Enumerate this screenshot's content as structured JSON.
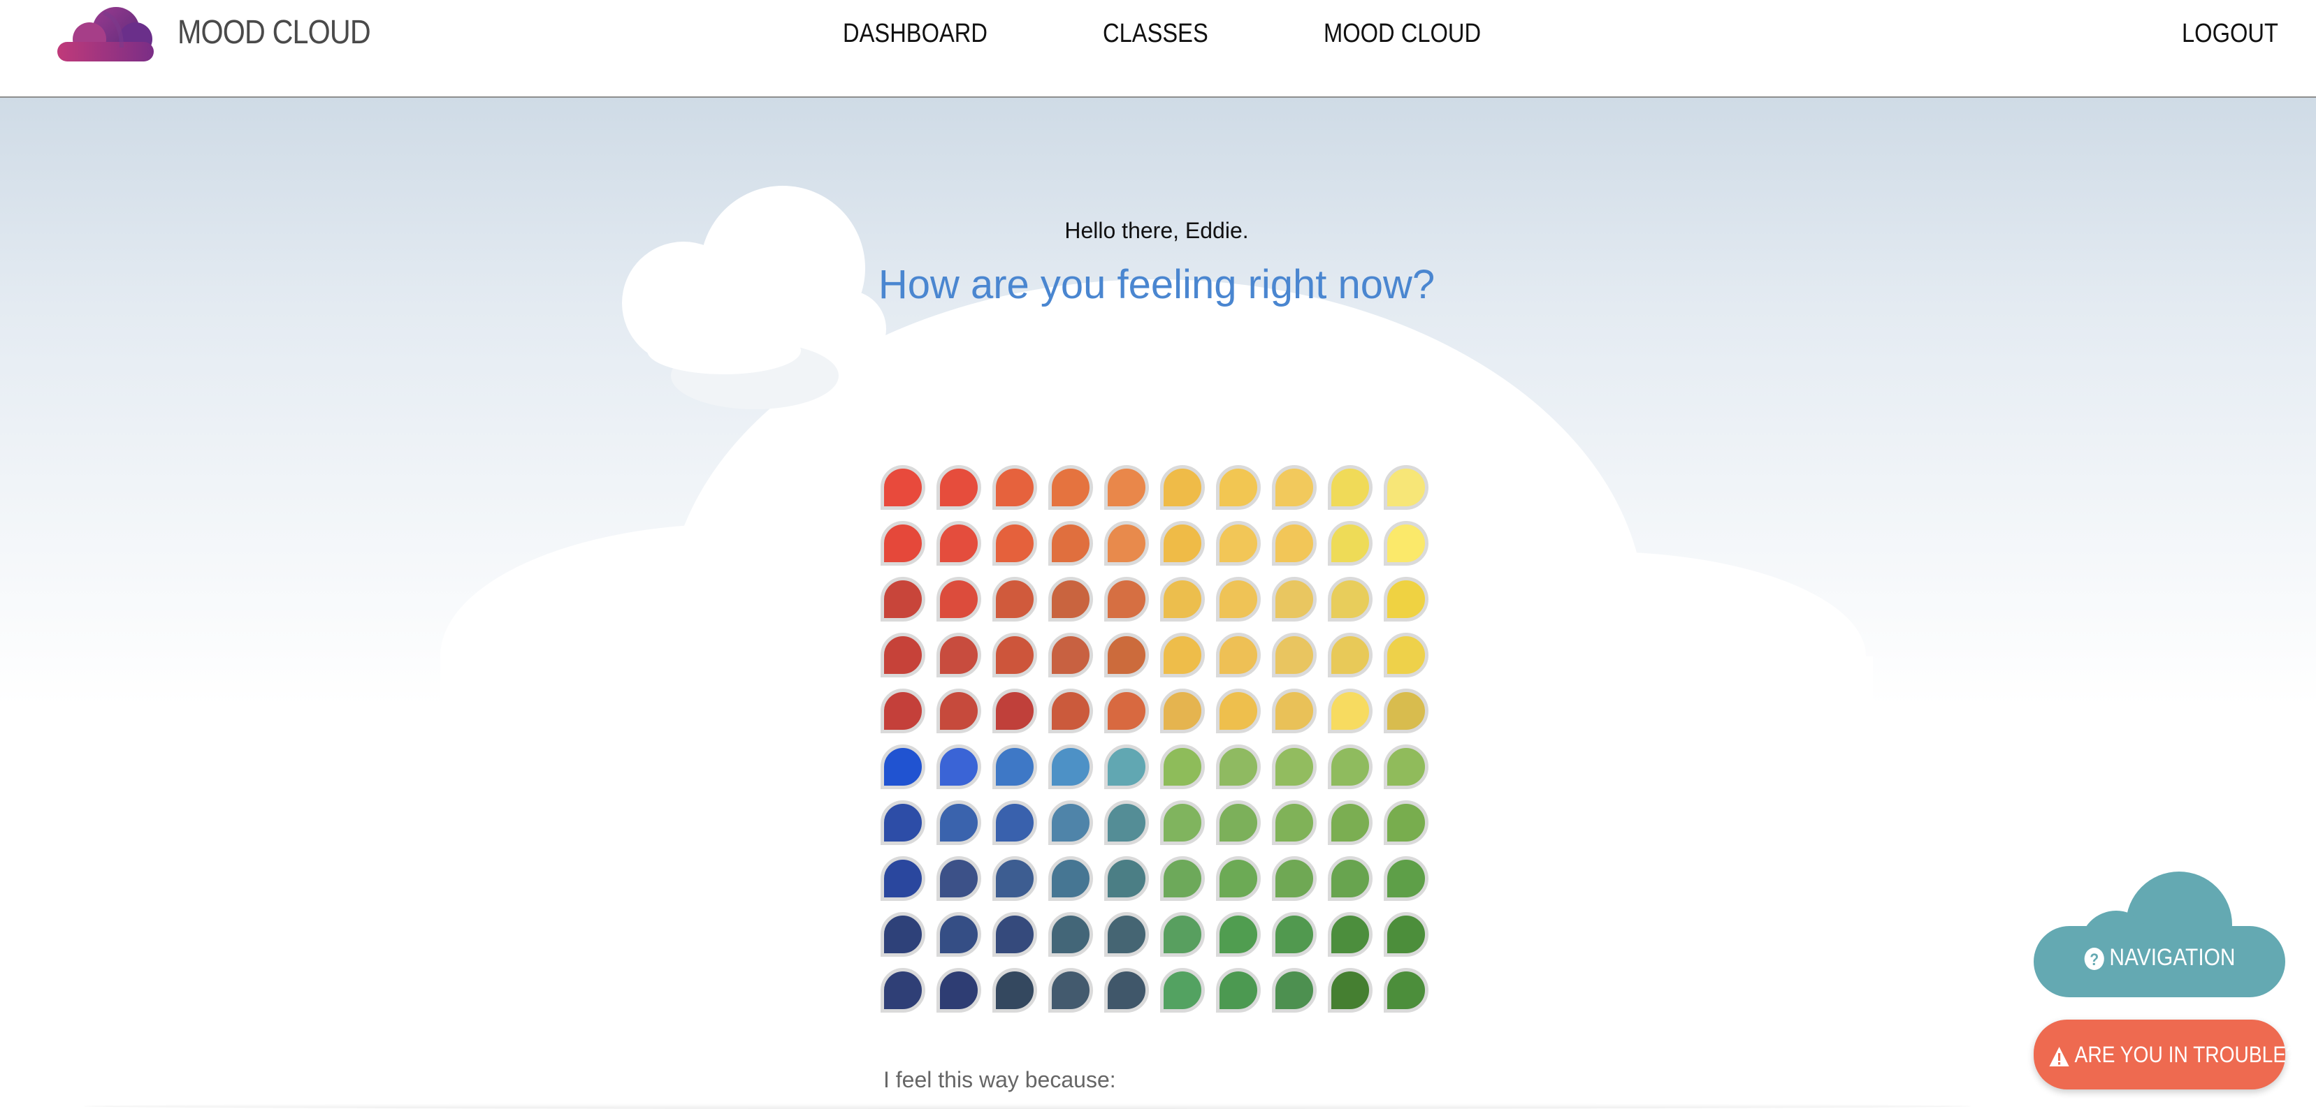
{
  "header": {
    "brand": "MOOD CLOUD",
    "logo_icon": "cloud-logo-icon",
    "nav": {
      "dashboard": "DASHBOARD",
      "classes": "CLASSES",
      "mood_cloud": "MOOD CLOUD",
      "logout": "LOGOUT"
    }
  },
  "main": {
    "greeting": "Hello there, Eddie.",
    "question": "How are you feeling right now?",
    "because_label": "I feel this way because:"
  },
  "mood_grid": {
    "rows": [
      [
        "#e84a3c",
        "#e64d3c",
        "#e6623d",
        "#e5733f",
        "#e9874a",
        "#efbb48",
        "#f2c652",
        "#f2c95c",
        "#f0da58",
        "#f7e677"
      ],
      [
        "#e5483a",
        "#e44d3d",
        "#e5613c",
        "#e06f3e",
        "#e88a4c",
        "#efbb47",
        "#f2c657",
        "#f2c658",
        "#eedb57",
        "#fbe96a"
      ],
      [
        "#c8453a",
        "#dc4c3c",
        "#d05a3c",
        "#c9643f",
        "#d66f42",
        "#ecbe4d",
        "#efc356",
        "#e9c660",
        "#e8cd5b",
        "#efd242"
      ],
      [
        "#c64239",
        "#c84c3e",
        "#cd553b",
        "#c86141",
        "#cc6b3c",
        "#eebd4a",
        "#eec055",
        "#e9c560",
        "#e8c958",
        "#eed14a"
      ],
      [
        "#c4403a",
        "#c64a3c",
        "#c0403a",
        "#cb5a3c",
        "#d86940",
        "#e5b44f",
        "#eebf4d",
        "#e9c158",
        "#f7db60",
        "#d8bc4e"
      ],
      [
        "#2053d1",
        "#3a64d6",
        "#3e78c6",
        "#4d91c6",
        "#61a7b2",
        "#8ebc5a",
        "#8fba61",
        "#92bc5f",
        "#8fbb5e",
        "#90bb5b"
      ],
      [
        "#2d4da7",
        "#3a63ad",
        "#3961ad",
        "#4f84a9",
        "#548d96",
        "#80b45e",
        "#7cb05a",
        "#80b258",
        "#7bae52",
        "#78ad4e"
      ],
      [
        "#2a479e",
        "#3c5188",
        "#3d5d91",
        "#467693",
        "#4b7e85",
        "#6da95a",
        "#6caa55",
        "#6fa854",
        "#68a44f",
        "#5e9f48"
      ],
      [
        "#2e4179",
        "#354e85",
        "#354a7c",
        "#436678",
        "#456573",
        "#589f5f",
        "#509d50",
        "#51994f",
        "#4c8e3d",
        "#4c8e3b"
      ],
      [
        "#2f3f76",
        "#2e3d73",
        "#34485f",
        "#435a6e",
        "#40576a",
        "#53a261",
        "#4c9951",
        "#4d9050",
        "#457f31",
        "#4c8e3b"
      ]
    ]
  },
  "floating": {
    "navigation_label": "NAVIGATION",
    "navigation_icon": "question-circle-icon",
    "navigation_color": "#64a9b2",
    "trouble_label": "ARE YOU IN TROUBLE?",
    "trouble_icon": "warning-triangle-icon",
    "trouble_color": "#ee6a50"
  }
}
